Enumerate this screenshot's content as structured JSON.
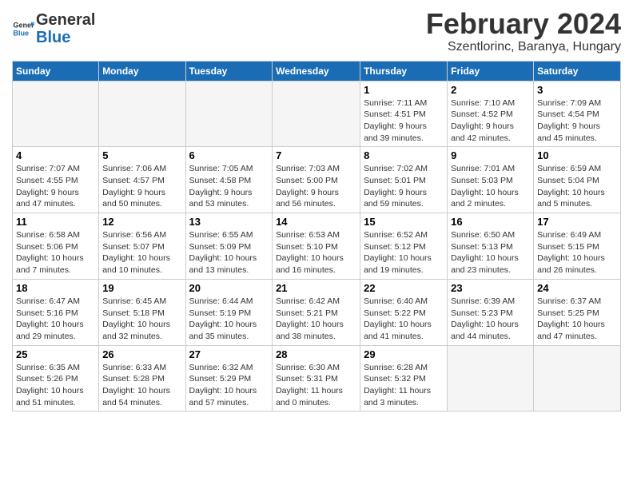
{
  "header": {
    "logo_text_general": "General",
    "logo_text_blue": "Blue",
    "month_title": "February 2024",
    "location": "Szentlorinc, Baranya, Hungary"
  },
  "calendar": {
    "days_of_week": [
      "Sunday",
      "Monday",
      "Tuesday",
      "Wednesday",
      "Thursday",
      "Friday",
      "Saturday"
    ],
    "weeks": [
      [
        {
          "day": "",
          "info": ""
        },
        {
          "day": "",
          "info": ""
        },
        {
          "day": "",
          "info": ""
        },
        {
          "day": "",
          "info": ""
        },
        {
          "day": "1",
          "info": "Sunrise: 7:11 AM\nSunset: 4:51 PM\nDaylight: 9 hours\nand 39 minutes."
        },
        {
          "day": "2",
          "info": "Sunrise: 7:10 AM\nSunset: 4:52 PM\nDaylight: 9 hours\nand 42 minutes."
        },
        {
          "day": "3",
          "info": "Sunrise: 7:09 AM\nSunset: 4:54 PM\nDaylight: 9 hours\nand 45 minutes."
        }
      ],
      [
        {
          "day": "4",
          "info": "Sunrise: 7:07 AM\nSunset: 4:55 PM\nDaylight: 9 hours\nand 47 minutes."
        },
        {
          "day": "5",
          "info": "Sunrise: 7:06 AM\nSunset: 4:57 PM\nDaylight: 9 hours\nand 50 minutes."
        },
        {
          "day": "6",
          "info": "Sunrise: 7:05 AM\nSunset: 4:58 PM\nDaylight: 9 hours\nand 53 minutes."
        },
        {
          "day": "7",
          "info": "Sunrise: 7:03 AM\nSunset: 5:00 PM\nDaylight: 9 hours\nand 56 minutes."
        },
        {
          "day": "8",
          "info": "Sunrise: 7:02 AM\nSunset: 5:01 PM\nDaylight: 9 hours\nand 59 minutes."
        },
        {
          "day": "9",
          "info": "Sunrise: 7:01 AM\nSunset: 5:03 PM\nDaylight: 10 hours\nand 2 minutes."
        },
        {
          "day": "10",
          "info": "Sunrise: 6:59 AM\nSunset: 5:04 PM\nDaylight: 10 hours\nand 5 minutes."
        }
      ],
      [
        {
          "day": "11",
          "info": "Sunrise: 6:58 AM\nSunset: 5:06 PM\nDaylight: 10 hours\nand 7 minutes."
        },
        {
          "day": "12",
          "info": "Sunrise: 6:56 AM\nSunset: 5:07 PM\nDaylight: 10 hours\nand 10 minutes."
        },
        {
          "day": "13",
          "info": "Sunrise: 6:55 AM\nSunset: 5:09 PM\nDaylight: 10 hours\nand 13 minutes."
        },
        {
          "day": "14",
          "info": "Sunrise: 6:53 AM\nSunset: 5:10 PM\nDaylight: 10 hours\nand 16 minutes."
        },
        {
          "day": "15",
          "info": "Sunrise: 6:52 AM\nSunset: 5:12 PM\nDaylight: 10 hours\nand 19 minutes."
        },
        {
          "day": "16",
          "info": "Sunrise: 6:50 AM\nSunset: 5:13 PM\nDaylight: 10 hours\nand 23 minutes."
        },
        {
          "day": "17",
          "info": "Sunrise: 6:49 AM\nSunset: 5:15 PM\nDaylight: 10 hours\nand 26 minutes."
        }
      ],
      [
        {
          "day": "18",
          "info": "Sunrise: 6:47 AM\nSunset: 5:16 PM\nDaylight: 10 hours\nand 29 minutes."
        },
        {
          "day": "19",
          "info": "Sunrise: 6:45 AM\nSunset: 5:18 PM\nDaylight: 10 hours\nand 32 minutes."
        },
        {
          "day": "20",
          "info": "Sunrise: 6:44 AM\nSunset: 5:19 PM\nDaylight: 10 hours\nand 35 minutes."
        },
        {
          "day": "21",
          "info": "Sunrise: 6:42 AM\nSunset: 5:21 PM\nDaylight: 10 hours\nand 38 minutes."
        },
        {
          "day": "22",
          "info": "Sunrise: 6:40 AM\nSunset: 5:22 PM\nDaylight: 10 hours\nand 41 minutes."
        },
        {
          "day": "23",
          "info": "Sunrise: 6:39 AM\nSunset: 5:23 PM\nDaylight: 10 hours\nand 44 minutes."
        },
        {
          "day": "24",
          "info": "Sunrise: 6:37 AM\nSunset: 5:25 PM\nDaylight: 10 hours\nand 47 minutes."
        }
      ],
      [
        {
          "day": "25",
          "info": "Sunrise: 6:35 AM\nSunset: 5:26 PM\nDaylight: 10 hours\nand 51 minutes."
        },
        {
          "day": "26",
          "info": "Sunrise: 6:33 AM\nSunset: 5:28 PM\nDaylight: 10 hours\nand 54 minutes."
        },
        {
          "day": "27",
          "info": "Sunrise: 6:32 AM\nSunset: 5:29 PM\nDaylight: 10 hours\nand 57 minutes."
        },
        {
          "day": "28",
          "info": "Sunrise: 6:30 AM\nSunset: 5:31 PM\nDaylight: 11 hours\nand 0 minutes."
        },
        {
          "day": "29",
          "info": "Sunrise: 6:28 AM\nSunset: 5:32 PM\nDaylight: 11 hours\nand 3 minutes."
        },
        {
          "day": "",
          "info": ""
        },
        {
          "day": "",
          "info": ""
        }
      ]
    ]
  }
}
